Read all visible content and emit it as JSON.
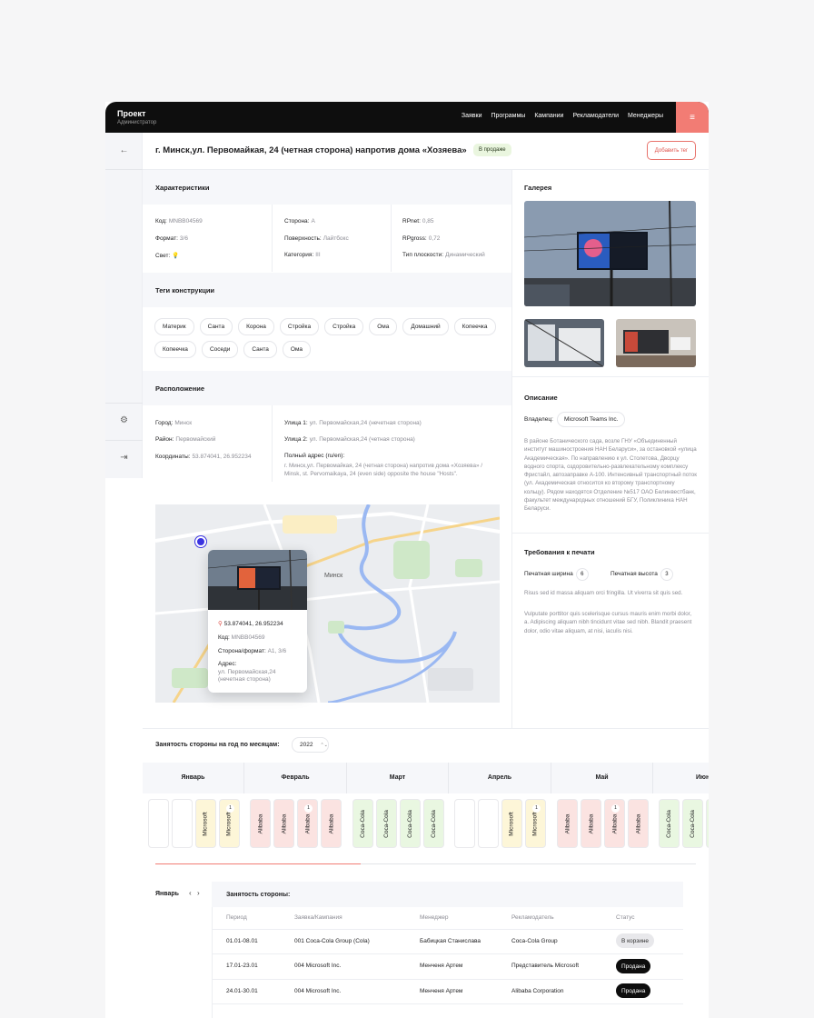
{
  "header": {
    "brand_title": "Проект",
    "brand_subtitle": "Администратор",
    "nav": [
      "Заявки",
      "Программы",
      "Кампании",
      "Рекламодатели",
      "Менеджеры"
    ],
    "menu_icon": "hamburger-icon"
  },
  "page": {
    "title": "г. Минск,ул. Первомайкая, 24 (четная сторона) напротив дома «Хозяева»",
    "status_badge": "В продаже",
    "add_tag_button": "Добавить тег",
    "back_icon": "←",
    "settings_icon": "⚙",
    "logout_icon": "⇥"
  },
  "characteristics": {
    "title": "Характеристики",
    "col1": [
      {
        "k": "Код:",
        "v": "MNBB04569"
      },
      {
        "k": "Формат:",
        "v": "3/6"
      },
      {
        "k": "Свет:",
        "v": "💡"
      }
    ],
    "col2": [
      {
        "k": "Сторона:",
        "v": "A"
      },
      {
        "k": "Поверхность:",
        "v": "Лайтбокс"
      },
      {
        "k": "Категория:",
        "v": "III"
      }
    ],
    "col3": [
      {
        "k": "RPnet:",
        "v": "0,85"
      },
      {
        "k": "RPgross:",
        "v": "0,72"
      },
      {
        "k": "Тип плоскости:",
        "v": "Динамический"
      }
    ]
  },
  "tags": {
    "title": "Теги конструкции",
    "items": [
      "Материк",
      "Санта",
      "Корона",
      "Стройка",
      "Стройка",
      "Ома",
      "Домашний",
      "Копеечка",
      "Копеечка",
      "Соседи",
      "Санта",
      "Ома"
    ]
  },
  "location": {
    "title": "Расположение",
    "col1": [
      {
        "k": "Город:",
        "v": "Минск"
      },
      {
        "k": "Район:",
        "v": "Первомайский"
      },
      {
        "k": "Координаты:",
        "v": "53.874041, 26.952234"
      }
    ],
    "col2": [
      {
        "k": "Улица 1:",
        "v": "ул. Первомайская,24 (нечетная сторона)"
      },
      {
        "k": "Улица 2:",
        "v": "ул. Первомайская,24 (четная сторона)"
      }
    ],
    "full_address_label": "Полный адрес (ru/en):",
    "full_address": "г. Минск,ул. Первомайкая, 24 (четная сторона) напротив дома «Хозяева» / Minsk, st. Pervomaikaya, 24 (even side) opposite the house \"Hosts\"."
  },
  "map": {
    "city_label": "Минск",
    "popup": {
      "coords": "53.874041, 26.952234",
      "code_label": "Код:",
      "code": "MNBB04569",
      "side_label": "Сторона/формат:",
      "side": "A1, 3/6",
      "address_label": "Адрес:",
      "address": "ул. Первомайская,24 (нечетная сторона)"
    }
  },
  "gallery": {
    "title": "Галерея"
  },
  "description": {
    "title": "Описание",
    "owner_label": "Владелец:",
    "owner": "Microsoft Teams Inc.",
    "text": "В районе Ботанического сада, возле ГНУ «Объединенный институт машиностроения НАН Беларуси», за остановкой «улица Академическая». По направлению к ул. Столетова, Дворцу водного спорта, оздоровительно-развлекательному комплексу Фристайл, автозаправке А-100. Интенсивный транспортный поток (ул. Академическая относится ко второму транспортному кольцу). Рядом находятся Отделение №517 ОАО Белинвестбанк, факультет международных отношений БГУ, Поликлиника НАН Беларуси."
  },
  "print": {
    "title": "Требования к печати",
    "width_label": "Печатная ширина",
    "width": "6",
    "height_label": "Печатная высота",
    "height": "3",
    "text1": "Risus sed id massa aliquam orci fringilla. Ut viverra sit quis sed.",
    "text2": "Vulputate porttitor quis scelerisque cursus mauris enim morbi dolor, a. Adipiscing aliquam nibh tincidunt vitae sed nibh. Blandit praesent dolor, odio vitae aliquam, at nisi, iaculis nisi."
  },
  "occupancy": {
    "title": "Занятость стороны на год по месяцам:",
    "year": "2022",
    "months": [
      "Январь",
      "Февраль",
      "Март",
      "Апрель",
      "Май",
      "Июнь"
    ],
    "progress": 0.38
  },
  "booking": {
    "month": "Январь",
    "title": "Занятость стороны:",
    "columns": [
      "Период",
      "Заявка/Кампания",
      "Менеджер",
      "Рекламодатель",
      "Статус"
    ],
    "rows": [
      {
        "period": "01.01-08.01",
        "campaign": "001 Coca-Cola Group (Cola)",
        "manager": "Бабицкая Станислава",
        "advertiser": "Coca-Cola Group",
        "status": "В корзине"
      },
      {
        "period": "17.01-23.01",
        "campaign": "004 Microsoft Inc.",
        "manager": "Менченя Артем",
        "advertiser": "Представитель Microsoft",
        "status": "Продана"
      },
      {
        "period": "24.01-30.01",
        "campaign": "004 Microsoft Inc.",
        "manager": "Менченя Артем",
        "advertiser": "Alibaba Corporation",
        "status": "Продана"
      }
    ]
  },
  "colors": {
    "accent": "#f27c74",
    "microsoft": "#fdf6d8",
    "alibaba": "#fbe3e1",
    "cocacola": "#e9f7e1"
  }
}
